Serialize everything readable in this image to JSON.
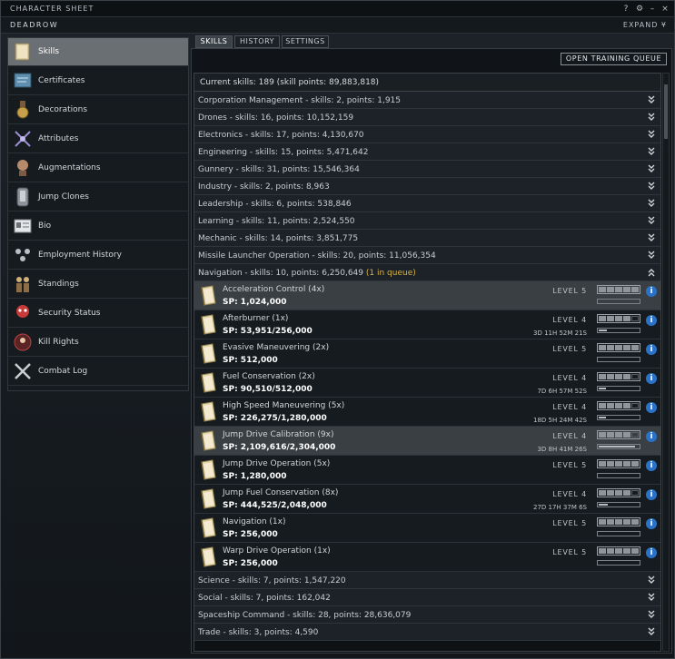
{
  "window": {
    "title": "CHARACTER SHEET",
    "char_name": "DEADROW",
    "expand_label": "EXPAND",
    "help": "?",
    "settings": "⚙",
    "minimize": "–",
    "close": "×"
  },
  "sidebar": {
    "items": [
      {
        "label": "Skills",
        "icon": "skillbook-icon",
        "active": true
      },
      {
        "label": "Certificates",
        "icon": "certificate-icon"
      },
      {
        "label": "Decorations",
        "icon": "medal-icon"
      },
      {
        "label": "Attributes",
        "icon": "attributes-icon"
      },
      {
        "label": "Augmentations",
        "icon": "implant-icon"
      },
      {
        "label": "Jump Clones",
        "icon": "clone-icon"
      },
      {
        "label": "Bio",
        "icon": "bio-icon"
      },
      {
        "label": "Employment History",
        "icon": "employment-icon"
      },
      {
        "label": "Standings",
        "icon": "standings-icon"
      },
      {
        "label": "Security Status",
        "icon": "security-icon"
      },
      {
        "label": "Kill Rights",
        "icon": "killrights-icon"
      },
      {
        "label": "Combat Log",
        "icon": "combatlog-icon"
      }
    ]
  },
  "tabs": [
    "SKILLS",
    "HISTORY",
    "SETTINGS"
  ],
  "open_training_queue": "OPEN TRAINING QUEUE",
  "summary": "Current skills: 189 (skill points: 89,883,818)",
  "groups_top": [
    "Corporation Management - skills: 2, points: 1,915",
    "Drones - skills: 16, points: 10,152,159",
    "Electronics - skills: 17, points: 4,130,670",
    "Engineering - skills: 15, points: 5,471,642",
    "Gunnery - skills: 31, points: 15,546,364",
    "Industry - skills: 2, points: 8,963",
    "Leadership - skills: 6, points: 538,846",
    "Learning - skills: 11, points: 2,524,550",
    "Mechanic - skills: 14, points: 3,851,775",
    "Missile Launcher Operation - skills: 20, points: 11,056,354"
  ],
  "navigation_group": {
    "label": "Navigation - skills: 10, points: 6,250,649",
    "queue": "(1 in queue)"
  },
  "skills": [
    {
      "name": "Acceleration Control (4x)",
      "sp": "SP: 1,024,000",
      "level": "LEVEL 5",
      "lvl": 5,
      "time": "",
      "progress": 0,
      "hl": true
    },
    {
      "name": "Afterburner (1x)",
      "sp": "SP: 53,951/256,000",
      "level": "LEVEL 4",
      "lvl": 4,
      "time": "3D 11H 52M 21S",
      "progress": 0.21,
      "hl": false
    },
    {
      "name": "Evasive Maneuvering (2x)",
      "sp": "SP: 512,000",
      "level": "LEVEL 5",
      "lvl": 5,
      "time": "",
      "progress": 0,
      "hl": false
    },
    {
      "name": "Fuel Conservation (2x)",
      "sp": "SP: 90,510/512,000",
      "level": "LEVEL 4",
      "lvl": 4,
      "time": "7D 6H 57M 52S",
      "progress": 0.18,
      "hl": false
    },
    {
      "name": "High Speed Maneuvering (5x)",
      "sp": "SP: 226,275/1,280,000",
      "level": "LEVEL 4",
      "lvl": 4,
      "time": "18D 5H 24M 42S",
      "progress": 0.18,
      "hl": false
    },
    {
      "name": "Jump Drive Calibration (9x)",
      "sp": "SP: 2,109,616/2,304,000",
      "level": "LEVEL 4",
      "lvl": 4,
      "time": "3D 8H 41M 26S",
      "progress": 0.92,
      "hl": true
    },
    {
      "name": "Jump Drive Operation (5x)",
      "sp": "SP: 1,280,000",
      "level": "LEVEL 5",
      "lvl": 5,
      "time": "",
      "progress": 0,
      "hl": false
    },
    {
      "name": "Jump Fuel Conservation (8x)",
      "sp": "SP: 444,525/2,048,000",
      "level": "LEVEL 4",
      "lvl": 4,
      "time": "27D 17H 37M 6S",
      "progress": 0.22,
      "hl": false
    },
    {
      "name": "Navigation (1x)",
      "sp": "SP: 256,000",
      "level": "LEVEL 5",
      "lvl": 5,
      "time": "",
      "progress": 0,
      "hl": false
    },
    {
      "name": "Warp Drive Operation (1x)",
      "sp": "SP: 256,000",
      "level": "LEVEL 5",
      "lvl": 5,
      "time": "",
      "progress": 0,
      "hl": false
    }
  ],
  "groups_bottom": [
    "Science - skills: 7, points: 1,547,220",
    "Social - skills: 7, points: 162,042",
    "Spaceship Command - skills: 28, points: 28,636,079",
    "Trade - skills: 3, points: 4,590"
  ],
  "colors": {
    "accent": "#2a72c8",
    "queue": "#d9b341",
    "active_tab": "#6a6f73"
  }
}
